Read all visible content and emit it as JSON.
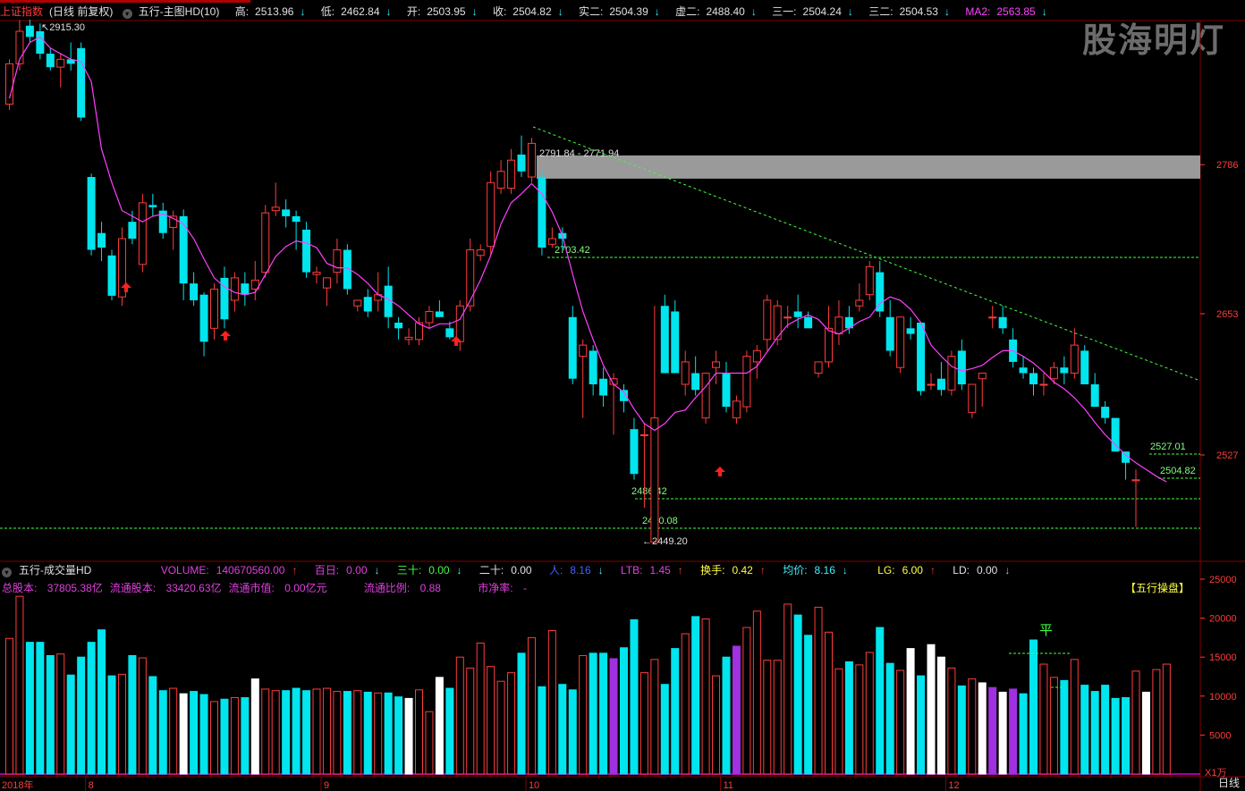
{
  "header": {
    "symbol": "上证指数",
    "mode": "(日线 前复权)",
    "indicator": "五行-主图HD(10)",
    "high_label": "高:",
    "high": "2513.96",
    "low_label": "低:",
    "low": "2462.84",
    "open_label": "开:",
    "open": "2503.95",
    "close_label": "收:",
    "close": "2504.82",
    "shi1_label": "实二:",
    "shi1": "2504.39",
    "xu2_label": "虚二:",
    "xu2": "2488.40",
    "san1_label": "三一:",
    "san1": "2504.24",
    "san2_label": "三二:",
    "san2": "2504.53",
    "ma2_label": "MA2:",
    "ma2": "2563.85"
  },
  "watermark": "股海明灯",
  "price_axis": {
    "ticks": [
      "2786",
      "2653",
      "2527"
    ]
  },
  "annotations": {
    "max_label": "2915.30",
    "min_label": "2449.20",
    "zone_label": "2791.84 - 2771.94",
    "levels": [
      "2703.42",
      "2486.42",
      "2460.08",
      "2527.01",
      "2504.82"
    ]
  },
  "volume_panel": {
    "title": "五行-成交量HD",
    "volume_label": "VOLUME:",
    "volume": "140670560.00",
    "bai_label": "百日:",
    "bai": "0.00",
    "sanshi_label": "三十:",
    "sanshi": "0.00",
    "ershi_label": "二十:",
    "ershi": "0.00",
    "ren_label": "人:",
    "ren": "8.16",
    "ltb_label": "LTB:",
    "ltb": "1.45",
    "hs_label": "换手:",
    "hs": "0.42",
    "jj_label": "均价:",
    "jj": "8.16",
    "lg_label": "LG:",
    "lg": "6.00",
    "ld_label": "LD:",
    "ld": "0.00",
    "stats": {
      "zgb_label": "总股本:",
      "zgb": "37805.38亿",
      "ltgb_label": "流通股本:",
      "ltgb": "33420.63亿",
      "ltsz_label": "流通市值:",
      "ltsz": "0.00亿元",
      "ltbl_label": "流通比例:",
      "ltbl": "0.88",
      "sjl_label": "市净率:",
      "sjl": "-"
    },
    "badge": "【五行操盘】",
    "ping": "平",
    "axis_ticks": [
      "25000",
      "20000",
      "15000",
      "10000",
      "5000"
    ],
    "unit": "X1万"
  },
  "time_axis": {
    "labels": [
      {
        "text": "2018年",
        "i": 0
      },
      {
        "text": "8",
        "i": 8
      },
      {
        "text": "9",
        "i": 31
      },
      {
        "text": "10",
        "i": 51
      },
      {
        "text": "11",
        "i": 70
      },
      {
        "text": "12",
        "i": 92
      }
    ],
    "period": "日线"
  },
  "colors": {
    "up": "#ff3c3c",
    "down": "#00e5ee",
    "ma": "#ff40ff",
    "grid": "#800000",
    "guide": "#40ff40"
  },
  "chart_data": {
    "type": "candlestick",
    "ma_label": "MA2",
    "candles": [
      [
        2840,
        2880,
        2835,
        2876
      ],
      [
        2876,
        2915,
        2870,
        2905
      ],
      [
        2910,
        2915.3,
        2895,
        2900
      ],
      [
        2905,
        2912,
        2880,
        2885
      ],
      [
        2885,
        2890,
        2870,
        2873
      ],
      [
        2873,
        2885,
        2855,
        2880
      ],
      [
        2880,
        2895,
        2870,
        2876
      ],
      [
        2890,
        2895,
        2825,
        2828
      ],
      [
        2775,
        2778,
        2705,
        2710
      ],
      [
        2725,
        2735,
        2700,
        2712
      ],
      [
        2705,
        2710,
        2665,
        2669
      ],
      [
        2668,
        2730,
        2660,
        2720
      ],
      [
        2735,
        2745,
        2715,
        2720
      ],
      [
        2697,
        2760,
        2690,
        2752
      ],
      [
        2750,
        2760,
        2740,
        2748
      ],
      [
        2745,
        2752,
        2720,
        2725
      ],
      [
        2730,
        2745,
        2710,
        2740
      ],
      [
        2740,
        2746,
        2665,
        2680
      ],
      [
        2680,
        2690,
        2660,
        2665
      ],
      [
        2670,
        2672,
        2615,
        2628
      ],
      [
        2640,
        2680,
        2630,
        2675
      ],
      [
        2685,
        2695,
        2640,
        2648
      ],
      [
        2665,
        2690,
        2655,
        2685
      ],
      [
        2680,
        2690,
        2660,
        2670
      ],
      [
        2675,
        2700,
        2665,
        2683
      ],
      [
        2690,
        2750,
        2685,
        2743
      ],
      [
        2745,
        2770,
        2740,
        2748
      ],
      [
        2746,
        2755,
        2730,
        2740
      ],
      [
        2740,
        2745,
        2710,
        2735
      ],
      [
        2728,
        2735,
        2685,
        2690
      ],
      [
        2688,
        2695,
        2680,
        2690
      ],
      [
        2676,
        2680,
        2660,
        2685
      ],
      [
        2690,
        2720,
        2680,
        2710
      ],
      [
        2710,
        2715,
        2670,
        2675
      ],
      [
        2660,
        2665,
        2655,
        2665
      ],
      [
        2668,
        2675,
        2650,
        2655
      ],
      [
        2665,
        2690,
        2655,
        2670
      ],
      [
        2678,
        2695,
        2640,
        2650
      ],
      [
        2645,
        2650,
        2630,
        2640
      ],
      [
        2630,
        2640,
        2625,
        2632
      ],
      [
        2630,
        2650,
        2625,
        2645
      ],
      [
        2645,
        2660,
        2640,
        2655
      ],
      [
        2655,
        2665,
        2650,
        2650
      ],
      [
        2640,
        2646,
        2630,
        2632
      ],
      [
        2628,
        2665,
        2620,
        2660
      ],
      [
        2660,
        2720,
        2655,
        2710
      ],
      [
        2705,
        2715,
        2700,
        2710
      ],
      [
        2713,
        2780,
        2705,
        2770
      ],
      [
        2765,
        2790,
        2760,
        2780
      ],
      [
        2765,
        2800,
        2760,
        2790
      ],
      [
        2795,
        2812,
        2775,
        2780
      ],
      [
        2775,
        2810,
        2770,
        2805
      ],
      [
        2775,
        2780,
        2705,
        2712
      ],
      [
        2715,
        2730,
        2712,
        2720
      ],
      [
        2725,
        2730,
        2710,
        2720
      ],
      [
        2650,
        2660,
        2590,
        2595
      ],
      [
        2615,
        2630,
        2560,
        2625
      ],
      [
        2620,
        2625,
        2580,
        2590
      ],
      [
        2595,
        2605,
        2570,
        2580
      ],
      [
        2590,
        2600,
        2545,
        2595
      ],
      [
        2585,
        2590,
        2565,
        2575
      ],
      [
        2550,
        2560,
        2505,
        2510
      ],
      [
        2545,
        2555,
        2480,
        2545
      ],
      [
        2449.2,
        2660,
        2449.2,
        2560
      ],
      [
        2660,
        2670,
        2600,
        2600
      ],
      [
        2655,
        2665,
        2610,
        2600
      ],
      [
        2590,
        2620,
        2580,
        2610
      ],
      [
        2600,
        2615,
        2580,
        2585
      ],
      [
        2560,
        2590,
        2555,
        2600
      ],
      [
        2605,
        2620,
        2590,
        2610
      ],
      [
        2600,
        2610,
        2565,
        2570
      ],
      [
        2560,
        2580,
        2555,
        2575
      ],
      [
        2570,
        2620,
        2565,
        2615
      ],
      [
        2610,
        2625,
        2595,
        2620
      ],
      [
        2630,
        2670,
        2620,
        2665
      ],
      [
        2630,
        2665,
        2625,
        2660
      ],
      [
        2650,
        2660,
        2640,
        2650
      ],
      [
        2655,
        2670,
        2640,
        2650
      ],
      [
        2650,
        2655,
        2640,
        2640
      ],
      [
        2600,
        2610,
        2596,
        2610
      ],
      [
        2610,
        2660,
        2605,
        2640
      ],
      [
        2635,
        2665,
        2625,
        2650
      ],
      [
        2650,
        2660,
        2635,
        2640
      ],
      [
        2660,
        2680,
        2655,
        2665
      ],
      [
        2670,
        2700,
        2665,
        2695
      ],
      [
        2690,
        2700,
        2650,
        2655
      ],
      [
        2650,
        2665,
        2615,
        2620
      ],
      [
        2605,
        2650,
        2600,
        2650
      ],
      [
        2640,
        2650,
        2630,
        2635
      ],
      [
        2645,
        2646,
        2580,
        2584
      ],
      [
        2590,
        2600,
        2585,
        2590
      ],
      [
        2595,
        2610,
        2580,
        2585
      ],
      [
        2585,
        2620,
        2580,
        2615
      ],
      [
        2620,
        2630,
        2585,
        2590
      ],
      [
        2565,
        2575,
        2560,
        2590
      ],
      [
        2595,
        2600,
        2570,
        2600
      ],
      [
        2650,
        2660,
        2640,
        2650
      ],
      [
        2650,
        2660,
        2635,
        2640
      ],
      [
        2630,
        2640,
        2605,
        2610
      ],
      [
        2605,
        2615,
        2595,
        2600
      ],
      [
        2600,
        2605,
        2580,
        2590
      ],
      [
        2590,
        2600,
        2580,
        2590
      ],
      [
        2595,
        2610,
        2590,
        2605
      ],
      [
        2605,
        2615,
        2590,
        2600
      ],
      [
        2600,
        2640,
        2595,
        2625
      ],
      [
        2620,
        2625,
        2590,
        2590
      ],
      [
        2590,
        2600,
        2575,
        2570
      ],
      [
        2570,
        2575,
        2555,
        2560
      ],
      [
        2560,
        2560,
        2530,
        2530
      ],
      [
        2530,
        2530,
        2505,
        2520
      ],
      [
        2503.95,
        2513.96,
        2462.84,
        2504.82
      ]
    ],
    "ma2": [
      2845,
      2880,
      2895,
      2900,
      2890,
      2885,
      2880,
      2878,
      2860,
      2800,
      2770,
      2745,
      2740,
      2735,
      2740,
      2742,
      2738,
      2733,
      2720,
      2702,
      2685,
      2677,
      2672,
      2670,
      2672,
      2688,
      2704,
      2713,
      2718,
      2716,
      2712,
      2698,
      2694,
      2694,
      2688,
      2680,
      2670,
      2666,
      2660,
      2652,
      2644,
      2640,
      2644,
      2644,
      2648,
      2665,
      2683,
      2705,
      2733,
      2752,
      2760,
      2769,
      2760,
      2744,
      2723,
      2688,
      2655,
      2630,
      2607,
      2590,
      2583,
      2568,
      2555,
      2549,
      2555,
      2565,
      2567,
      2578,
      2588,
      2600,
      2600,
      2600,
      2600,
      2606,
      2619,
      2632,
      2643,
      2648,
      2652,
      2648,
      2638,
      2635,
      2640,
      2646,
      2650,
      2662,
      2668,
      2665,
      2657,
      2645,
      2625,
      2615,
      2606,
      2602,
      2604,
      2607,
      2614,
      2620,
      2620,
      2615,
      2609,
      2601,
      2592,
      2586,
      2578,
      2568,
      2556,
      2545,
      2536,
      2527,
      2520,
      2514,
      2508,
      2503
    ],
    "volumes": [
      17400,
      22800,
      16900,
      16900,
      15200,
      15400,
      12700,
      15000,
      16900,
      18500,
      12600,
      12800,
      15200,
      14900,
      12500,
      10700,
      11000,
      10300,
      10600,
      10200,
      9300,
      9600,
      9800,
      9800,
      12200,
      10900,
      10700,
      10700,
      11000,
      10700,
      10900,
      11000,
      10600,
      10600,
      10700,
      10500,
      10400,
      10400,
      9900,
      9700,
      10800,
      8000,
      12400,
      11000,
      15000,
      13600,
      16800,
      13800,
      11900,
      13000,
      15500,
      17500,
      11200,
      18400,
      11500,
      10800,
      15200,
      15500,
      15500,
      14800,
      16200,
      19800,
      13000,
      14700,
      11500,
      16100,
      18000,
      20200,
      19900,
      12600,
      15000,
      16400,
      18800,
      20900,
      14600,
      14600,
      21800,
      20400,
      17800,
      21400,
      18200,
      13500,
      14400,
      14000,
      15600,
      18800,
      14200,
      13300,
      16100,
      12600,
      16600,
      15000,
      13600,
      11300,
      12200,
      11700,
      11100,
      10500,
      10900,
      10300,
      17200,
      14100,
      12400,
      12000,
      14700,
      11400,
      10600,
      11400,
      9700,
      9800,
      13200,
      10500,
      13400,
      14100
    ],
    "volume_colors": "mixed",
    "ylim": [
      2440,
      2930
    ],
    "vol_ylim": [
      0,
      26000
    ]
  }
}
